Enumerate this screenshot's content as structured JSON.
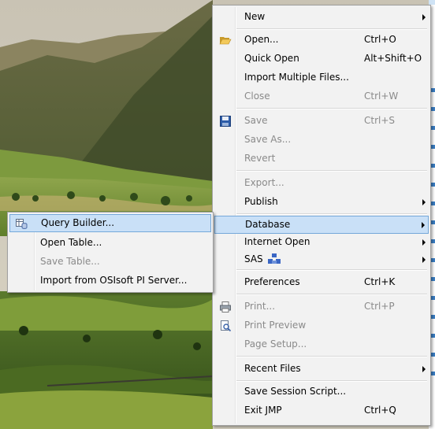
{
  "colors": {
    "menu_bg": "#f2f2f2",
    "highlight_bg": "#c9e0f7",
    "highlight_border": "#75a8d9",
    "disabled_text": "#8a8a8a"
  },
  "main_menu": {
    "items": [
      {
        "label": "New",
        "shortcut": "",
        "submenu": true,
        "enabled": true,
        "icon": ""
      },
      {
        "label": "Open...",
        "shortcut": "Ctrl+O",
        "submenu": false,
        "enabled": true,
        "icon": "folder-open-icon"
      },
      {
        "label": "Quick Open",
        "shortcut": "Alt+Shift+O",
        "submenu": false,
        "enabled": true,
        "icon": ""
      },
      {
        "label": "Import Multiple Files...",
        "shortcut": "",
        "submenu": false,
        "enabled": true,
        "icon": ""
      },
      {
        "label": "Close",
        "shortcut": "Ctrl+W",
        "submenu": false,
        "enabled": false,
        "icon": ""
      },
      {
        "label": "Save",
        "shortcut": "Ctrl+S",
        "submenu": false,
        "enabled": false,
        "icon": "floppy-disk-icon"
      },
      {
        "label": "Save As...",
        "shortcut": "",
        "submenu": false,
        "enabled": false,
        "icon": ""
      },
      {
        "label": "Revert",
        "shortcut": "",
        "submenu": false,
        "enabled": false,
        "icon": ""
      },
      {
        "label": "Export...",
        "shortcut": "",
        "submenu": false,
        "enabled": false,
        "icon": ""
      },
      {
        "label": "Publish",
        "shortcut": "",
        "submenu": true,
        "enabled": true,
        "icon": ""
      },
      {
        "label": "Database",
        "shortcut": "",
        "submenu": true,
        "enabled": true,
        "icon": "",
        "highlighted": true
      },
      {
        "label": "Internet Open",
        "shortcut": "",
        "submenu": true,
        "enabled": true,
        "icon": ""
      },
      {
        "label": "SAS",
        "shortcut": "",
        "submenu": true,
        "enabled": true,
        "icon": "sas-logo-icon"
      },
      {
        "label": "Preferences",
        "shortcut": "Ctrl+K",
        "submenu": false,
        "enabled": true,
        "icon": ""
      },
      {
        "label": "Print...",
        "shortcut": "Ctrl+P",
        "submenu": false,
        "enabled": false,
        "icon": "printer-icon"
      },
      {
        "label": "Print Preview",
        "shortcut": "",
        "submenu": false,
        "enabled": false,
        "icon": "print-preview-icon"
      },
      {
        "label": "Page Setup...",
        "shortcut": "",
        "submenu": false,
        "enabled": false,
        "icon": ""
      },
      {
        "label": "Recent Files",
        "shortcut": "",
        "submenu": true,
        "enabled": true,
        "icon": ""
      },
      {
        "label": "Save Session Script...",
        "shortcut": "",
        "submenu": false,
        "enabled": true,
        "icon": ""
      },
      {
        "label": "Exit JMP",
        "shortcut": "Ctrl+Q",
        "submenu": false,
        "enabled": true,
        "icon": ""
      }
    ]
  },
  "database_submenu": {
    "items": [
      {
        "label": "Query Builder...",
        "enabled": true,
        "highlighted": true,
        "icon": "query-builder-icon"
      },
      {
        "label": "Open Table...",
        "enabled": true,
        "icon": ""
      },
      {
        "label": "Save Table...",
        "enabled": false,
        "icon": ""
      },
      {
        "label": "Import from OSIsoft PI Server...",
        "enabled": true,
        "icon": ""
      }
    ]
  }
}
